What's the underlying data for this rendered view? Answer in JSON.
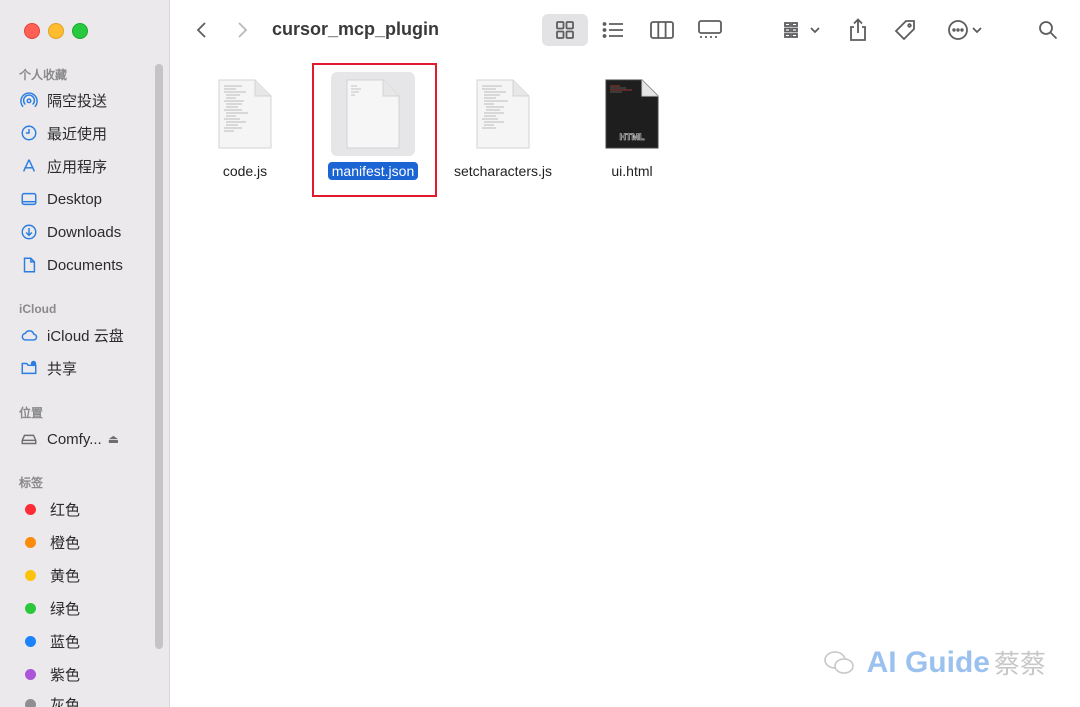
{
  "window": {
    "title": "cursor_mcp_plugin"
  },
  "sidebar": {
    "sections": [
      {
        "title": "个人收藏",
        "items": [
          {
            "label": "隔空投送",
            "icon": "airdrop-icon"
          },
          {
            "label": "最近使用",
            "icon": "clock-icon"
          },
          {
            "label": "应用程序",
            "icon": "applications-icon"
          },
          {
            "label": "Desktop",
            "icon": "desktop-icon"
          },
          {
            "label": "Downloads",
            "icon": "downloads-icon"
          },
          {
            "label": "Documents",
            "icon": "document-icon"
          }
        ]
      },
      {
        "title": "iCloud",
        "items": [
          {
            "label": "iCloud 云盘",
            "icon": "icloud-icon"
          },
          {
            "label": "共享",
            "icon": "shared-folder-icon"
          }
        ]
      },
      {
        "title": "位置",
        "items": [
          {
            "label": "Comfy...",
            "icon": "drive-icon",
            "eject": "⏏"
          }
        ]
      },
      {
        "title": "标签",
        "items": [
          {
            "label": "红色",
            "color": "#fe2b36"
          },
          {
            "label": "橙色",
            "color": "#fb8b0a"
          },
          {
            "label": "黄色",
            "color": "#fcc30d"
          },
          {
            "label": "绿色",
            "color": "#2cc83b"
          },
          {
            "label": "蓝色",
            "color": "#1a82fb"
          },
          {
            "label": "紫色",
            "color": "#ac55d8"
          },
          {
            "label": "灰色",
            "color": "#8e8e93"
          }
        ]
      }
    ]
  },
  "toolbar": {
    "buttons": [
      "back-icon",
      "forward-icon",
      "icon-view-icon",
      "list-view-icon",
      "column-view-icon",
      "gallery-view-icon",
      "group-icon",
      "share-icon",
      "tag-icon",
      "more-icon",
      "search-icon"
    ]
  },
  "files": [
    {
      "name": "code.js",
      "type": "js",
      "selected": false
    },
    {
      "name": "manifest.json",
      "type": "json",
      "selected": true
    },
    {
      "name": "setcharacters.js",
      "type": "js",
      "selected": false
    },
    {
      "name": "ui.html",
      "type": "html",
      "selected": false,
      "badge": "HTML"
    }
  ],
  "watermark": {
    "text": "AI Guide",
    "suffix": "蔡蔡"
  }
}
